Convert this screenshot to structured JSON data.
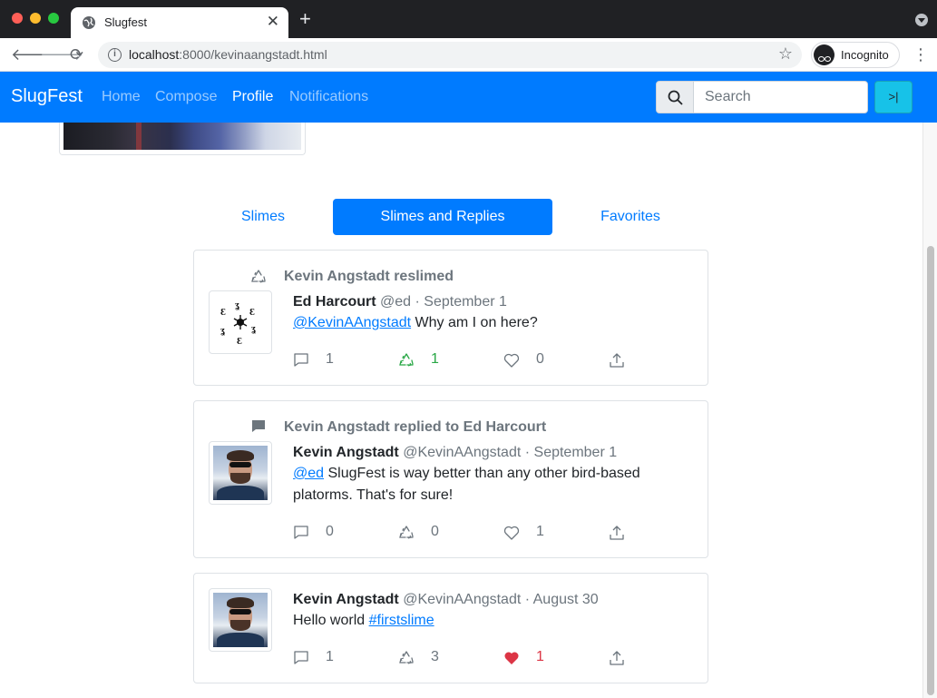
{
  "browser": {
    "tab_title": "Slugfest",
    "url_host": "localhost",
    "url_path": ":8000/kevinaangstadt.html",
    "incognito_label": "Incognito"
  },
  "nav": {
    "brand": "SlugFest",
    "links": [
      {
        "label": "Home",
        "active": false
      },
      {
        "label": "Compose",
        "active": false
      },
      {
        "label": "Profile",
        "active": true
      },
      {
        "label": "Notifications",
        "active": false
      }
    ],
    "search_placeholder": "Search",
    "search_button": ">|"
  },
  "tabs": [
    {
      "label": "Slimes",
      "active": false
    },
    {
      "label": "Slimes and Replies",
      "active": true
    },
    {
      "label": "Favorites",
      "active": false
    }
  ],
  "posts": [
    {
      "context": "Kevin Angstadt reslimed",
      "context_icon": "reslime-icon",
      "author_name": "Ed Harcourt",
      "author_meta": "@ed · September 1",
      "avatar": "slug-logo",
      "mention": "@KevinAAngstadt",
      "text": " Why am I on here?",
      "replies": "1",
      "reslimes": "1",
      "favorites": "0",
      "reslimed": true,
      "favorited": false
    },
    {
      "context": "Kevin Angstadt replied to Ed Harcourt",
      "context_icon": "reply-icon",
      "author_name": "Kevin Angstadt",
      "author_meta": "@KevinAAngstadt · September 1",
      "avatar": "kevin-photo",
      "mention": "@ed",
      "text": " SlugFest is way better than any other bird-based platorms. That's for sure!",
      "replies": "0",
      "reslimes": "0",
      "favorites": "1",
      "reslimed": false,
      "favorited": false
    },
    {
      "context": "",
      "author_name": "Kevin Angstadt",
      "author_meta": "@KevinAAngstadt · August 30",
      "avatar": "kevin-photo",
      "prefix": "Hello world ",
      "hashtag": "#firstslime",
      "replies": "1",
      "reslimes": "3",
      "favorites": "1",
      "reslimed": false,
      "favorited": true
    }
  ],
  "colors": {
    "primary": "#007bff",
    "info": "#17c2e8",
    "reslime_active": "#28a745",
    "favorite_active": "#dc3545",
    "muted": "#6c757d"
  }
}
